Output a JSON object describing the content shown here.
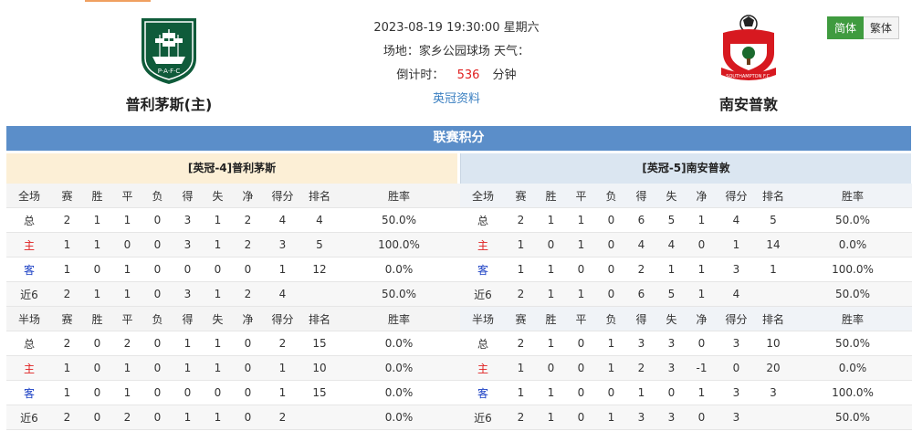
{
  "header": {
    "datetime": "2023-08-19 19:30:00 星期六",
    "venue_label": "场地：家乡公园球场 天气：",
    "countdown_label": "倒计时：",
    "countdown_value": "536",
    "countdown_unit": "分钟",
    "league_link": "英冠资料",
    "home_team": "普利茅斯(主)",
    "away_team": "南安普敦",
    "home_logo_text": "P·A·F·C",
    "away_logo_text": "SOUTHAMPTON F.C."
  },
  "lang": {
    "simplified": "简体",
    "traditional": "繁体"
  },
  "banner": "联赛积分",
  "colors": {
    "banner": "#5b8ec9",
    "home_panel": "#fcefd6",
    "away_panel": "#dbe6f1",
    "accent_green": "#3f9b3f",
    "home_red": "#e02020",
    "away_blue": "#1a3fc4"
  },
  "left": {
    "title": "[英冠-4]普利茅斯",
    "full_header": [
      "全场",
      "赛",
      "胜",
      "平",
      "负",
      "得",
      "失",
      "净",
      "得分",
      "排名",
      "胜率"
    ],
    "full_rows": [
      [
        "总",
        "2",
        "1",
        "1",
        "0",
        "3",
        "1",
        "2",
        "4",
        "4",
        "50.0%"
      ],
      [
        "主",
        "1",
        "1",
        "0",
        "0",
        "3",
        "1",
        "2",
        "3",
        "5",
        "100.0%"
      ],
      [
        "客",
        "1",
        "0",
        "1",
        "0",
        "0",
        "0",
        "0",
        "1",
        "12",
        "0.0%"
      ],
      [
        "近6",
        "2",
        "1",
        "1",
        "0",
        "3",
        "1",
        "2",
        "4",
        "",
        "50.0%"
      ]
    ],
    "half_header": [
      "半场",
      "赛",
      "胜",
      "平",
      "负",
      "得",
      "失",
      "净",
      "得分",
      "排名",
      "胜率"
    ],
    "half_rows": [
      [
        "总",
        "2",
        "0",
        "2",
        "0",
        "1",
        "1",
        "0",
        "2",
        "15",
        "0.0%"
      ],
      [
        "主",
        "1",
        "0",
        "1",
        "0",
        "1",
        "1",
        "0",
        "1",
        "10",
        "0.0%"
      ],
      [
        "客",
        "1",
        "0",
        "1",
        "0",
        "0",
        "0",
        "0",
        "1",
        "15",
        "0.0%"
      ],
      [
        "近6",
        "2",
        "0",
        "2",
        "0",
        "1",
        "1",
        "0",
        "2",
        "",
        "0.0%"
      ]
    ]
  },
  "right": {
    "title": "[英冠-5]南安普敦",
    "full_header": [
      "全场",
      "赛",
      "胜",
      "平",
      "负",
      "得",
      "失",
      "净",
      "得分",
      "排名",
      "胜率"
    ],
    "full_rows": [
      [
        "总",
        "2",
        "1",
        "1",
        "0",
        "6",
        "5",
        "1",
        "4",
        "5",
        "50.0%"
      ],
      [
        "主",
        "1",
        "0",
        "1",
        "0",
        "4",
        "4",
        "0",
        "1",
        "14",
        "0.0%"
      ],
      [
        "客",
        "1",
        "1",
        "0",
        "0",
        "2",
        "1",
        "1",
        "3",
        "1",
        "100.0%"
      ],
      [
        "近6",
        "2",
        "1",
        "1",
        "0",
        "6",
        "5",
        "1",
        "4",
        "",
        "50.0%"
      ]
    ],
    "half_header": [
      "半场",
      "赛",
      "胜",
      "平",
      "负",
      "得",
      "失",
      "净",
      "得分",
      "排名",
      "胜率"
    ],
    "half_rows": [
      [
        "总",
        "2",
        "1",
        "0",
        "1",
        "3",
        "3",
        "0",
        "3",
        "10",
        "50.0%"
      ],
      [
        "主",
        "1",
        "0",
        "0",
        "1",
        "2",
        "3",
        "-1",
        "0",
        "20",
        "0.0%"
      ],
      [
        "客",
        "1",
        "1",
        "0",
        "0",
        "1",
        "0",
        "1",
        "3",
        "3",
        "100.0%"
      ],
      [
        "近6",
        "2",
        "1",
        "0",
        "1",
        "3",
        "3",
        "0",
        "3",
        "",
        "50.0%"
      ]
    ]
  }
}
